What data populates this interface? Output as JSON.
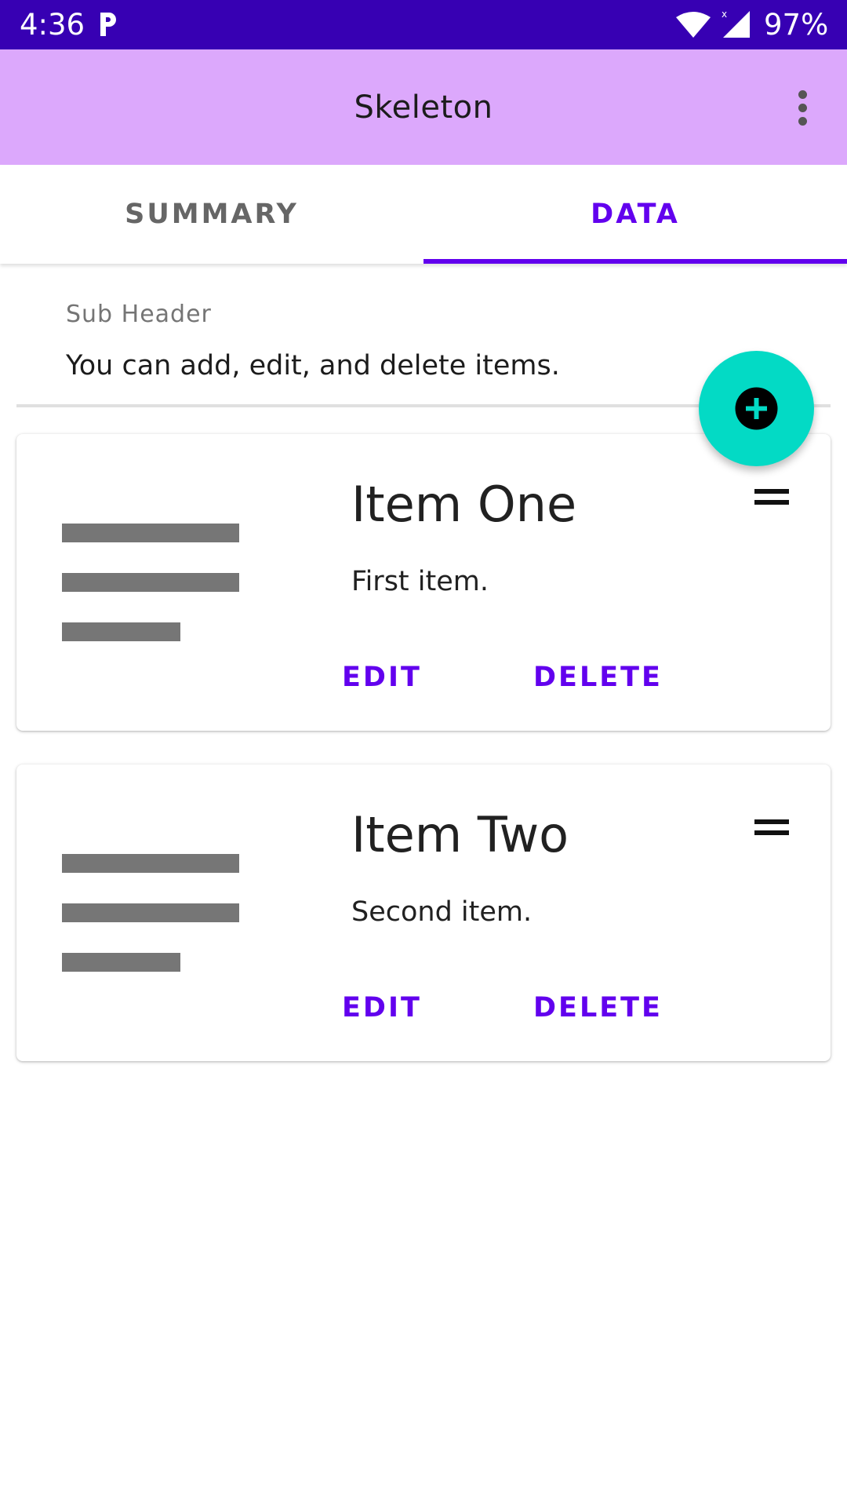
{
  "status_bar": {
    "time": "4:36",
    "battery": "97%",
    "icons": [
      "parking-notification-icon",
      "wifi-icon",
      "cell-signal-icon"
    ]
  },
  "app_bar": {
    "title": "Skeleton",
    "menu_icon": "more-vert-icon"
  },
  "tabs": [
    {
      "label": "SUMMARY",
      "selected": false
    },
    {
      "label": "DATA",
      "selected": true
    }
  ],
  "content": {
    "sub_header": "Sub Header",
    "description": "You can add, edit, and delete items."
  },
  "fab": {
    "icon": "add-circle-icon"
  },
  "items": [
    {
      "title": "Item One",
      "subtitle": "First item.",
      "edit_label": "EDIT",
      "delete_label": "DELETE"
    },
    {
      "title": "Item Two",
      "subtitle": "Second item.",
      "edit_label": "EDIT",
      "delete_label": "DELETE"
    }
  ],
  "colors": {
    "status_bar": "#3700b3",
    "app_bar": "#dca8fc",
    "accent": "#6200ee",
    "fab": "#03dac5"
  }
}
